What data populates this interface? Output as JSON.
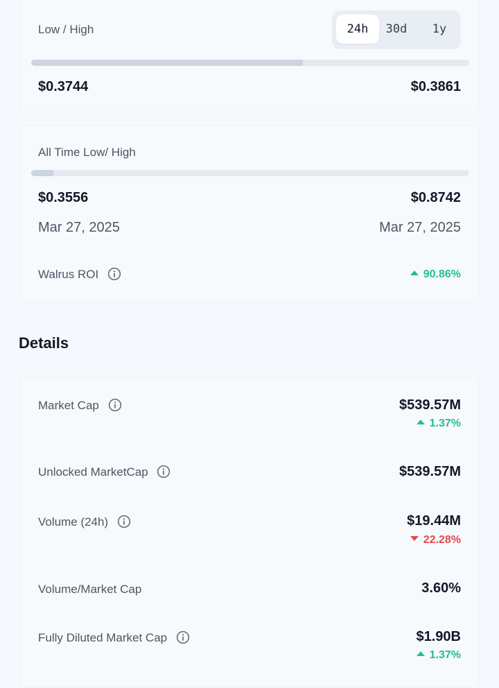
{
  "range24": {
    "label": "Low / High",
    "tabs": [
      "24h",
      "30d",
      "1y"
    ],
    "active_tab": "24h",
    "low": "$0.3744",
    "high": "$0.3861",
    "progress_fraction": 0.62
  },
  "ath": {
    "label": "All Time Low/ High",
    "low": "$0.3556",
    "high": "$0.8742",
    "low_date": "Mar 27, 2025",
    "high_date": "Mar 27, 2025",
    "progress_fraction": 0.05,
    "roi_label": "Walrus ROI",
    "roi_value": "90.86%",
    "roi_direction": "up"
  },
  "details": {
    "heading": "Details",
    "rows": [
      {
        "label": "Market Cap",
        "value": "$539.57M",
        "change": "1.37%",
        "direction": "up",
        "info": true
      },
      {
        "label": "Unlocked MarketCap",
        "value": "$539.57M",
        "info": true
      },
      {
        "label": "Volume (24h)",
        "value": "$19.44M",
        "change": "22.28%",
        "direction": "down",
        "info": true
      },
      {
        "label": "Volume/Market Cap",
        "value": "3.60%",
        "info": false
      },
      {
        "label": "Fully Diluted Market Cap",
        "value": "$1.90B",
        "change": "1.37%",
        "direction": "up",
        "info": true
      }
    ]
  },
  "colors": {
    "up": "#22c08a",
    "down": "#e5484d",
    "accent_bar": "#ccd4de"
  }
}
